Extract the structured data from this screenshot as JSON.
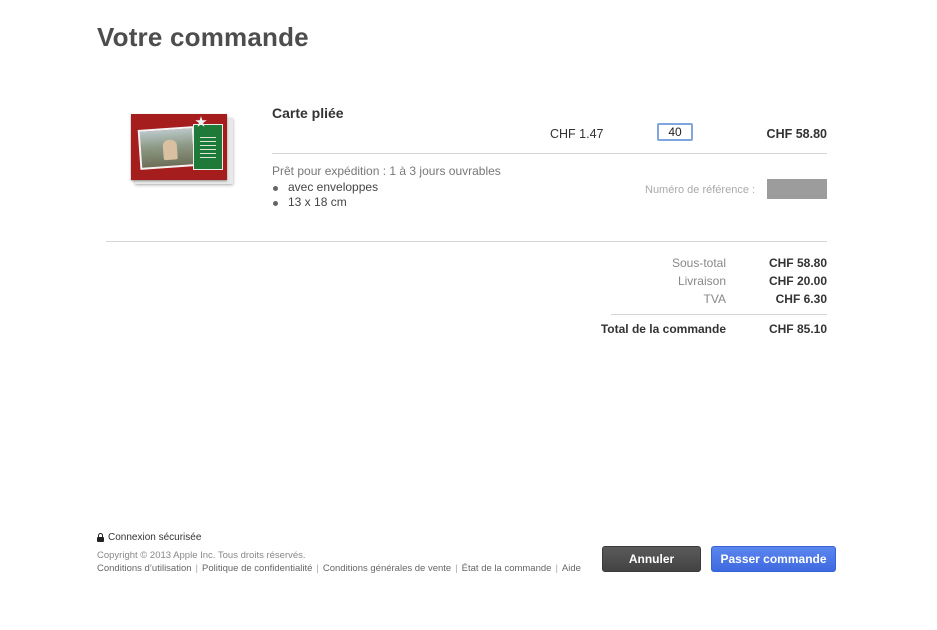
{
  "page": {
    "title": "Votre commande"
  },
  "item": {
    "name": "Carte pliée",
    "unit_price": "CHF 1.47",
    "quantity": "40",
    "line_total": "CHF 58.80",
    "shipping_info": "Prêt pour expédition : 1 à 3 jours ouvrables",
    "features": [
      "avec enveloppes",
      "13 x 18 cm"
    ],
    "reference_label": "Numéro de référence :",
    "reference_value": ""
  },
  "summary": {
    "subtotal_label": "Sous-total",
    "subtotal_value": "CHF 58.80",
    "shipping_label": "Livraison",
    "shipping_value": "CHF 20.00",
    "tax_label": "TVA",
    "tax_value": "CHF 6.30",
    "total_label": "Total de la commande",
    "total_value": "CHF 85.10"
  },
  "footer": {
    "secure": "Connexion sécurisée",
    "copyright": "Copyright © 2013 Apple Inc. Tous droits réservés.",
    "links": [
      "Conditions d’utilisation",
      "Politique de confidentialité",
      "Conditions générales de vente",
      "État de la commande",
      "Aide"
    ]
  },
  "actions": {
    "cancel": "Annuler",
    "order": "Passer commande"
  },
  "icons": {
    "lock": "lock-icon"
  },
  "colors": {
    "primary_button": "#4a74e6",
    "cancel_button": "#4d4d4d",
    "card_red": "#a51d1d",
    "card_green": "#1f7a3a"
  }
}
